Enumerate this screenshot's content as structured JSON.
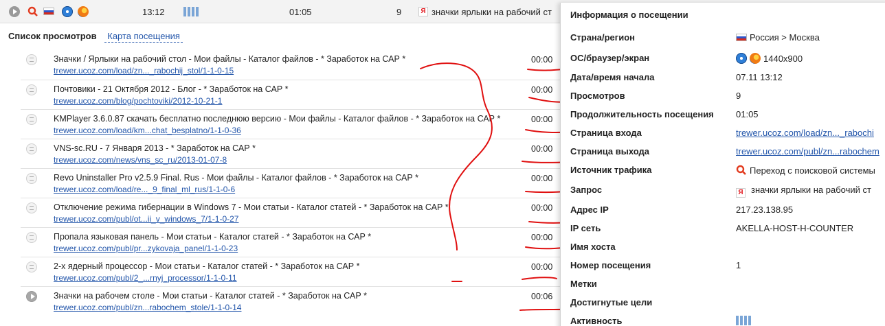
{
  "topbar": {
    "start_time": "13:12",
    "duration": "01:05",
    "views": "9",
    "query": "значки ярлыки на рабочий ст",
    "icons": [
      "play-icon",
      "search-icon",
      "flag-ru-icon",
      "windows-icon",
      "firefox-icon",
      "activity-bars-icon",
      "yandex-icon"
    ]
  },
  "list": {
    "title": "Список просмотров",
    "map_link": "Карта посещения",
    "rows": [
      {
        "title": "Значки / Ярлыки на рабочий стол - Мои файлы - Каталог файлов - * Заработок на САР *",
        "url": "trewer.ucoz.com/load/zn..._rabochij_stol/1-1-0-15",
        "time": "00:00",
        "icon": "doc-icon"
      },
      {
        "title": "Почтовики - 21 Октября 2012 - Блог - * Заработок на САР *",
        "url": "trewer.ucoz.com/blog/pochtoviki/2012-10-21-1",
        "time": "00:00",
        "icon": "doc-icon"
      },
      {
        "title": "KMPlayer 3.6.0.87 скачать бесплатно последнюю версию - Мои файлы - Каталог файлов - * Заработок на САР *",
        "url": "trewer.ucoz.com/load/km...chat_besplatno/1-1-0-36",
        "time": "00:00",
        "icon": "doc-icon"
      },
      {
        "title": "VNS-sc.RU - 7 Января 2013 - * Заработок на САР *",
        "url": "trewer.ucoz.com/news/vns_sc_ru/2013-01-07-8",
        "time": "00:00",
        "icon": "doc-icon"
      },
      {
        "title": "Revo Uninstaller Pro v2.5.9 Final. Rus - Мои файлы - Каталог файлов - * Заработок на САР *",
        "url": "trewer.ucoz.com/load/re..._9_final_ml_rus/1-1-0-6",
        "time": "00:00",
        "icon": "doc-icon"
      },
      {
        "title": "Отключение режима гибернации в Windows 7 - Мои статьи - Каталог статей - * Заработок на САР *",
        "url": "trewer.ucoz.com/publ/ot...ii_v_windows_7/1-1-0-27",
        "time": "00:00",
        "icon": "doc-icon"
      },
      {
        "title": "Пропала языковая панель - Мои статьи - Каталог статей - * Заработок на САР *",
        "url": "trewer.ucoz.com/publ/pr...zykovaja_panel/1-1-0-23",
        "time": "00:00",
        "icon": "doc-icon"
      },
      {
        "title": "2-х ядерный процессор - Мои статьи - Каталог статей - * Заработок на САР *",
        "url": "trewer.ucoz.com/publ/2_...rnyj_processor/1-1-0-11",
        "time": "00:00",
        "icon": "doc-icon"
      },
      {
        "title": "Значки на рабочем столе - Мои статьи - Каталог статей - * Заработок на САР *",
        "url": "trewer.ucoz.com/publ/zn...rabochem_stole/1-1-0-14",
        "time": "00:06",
        "icon": "play-icon"
      }
    ]
  },
  "panel": {
    "title": "Информация о посещении",
    "fields": [
      {
        "label": "Страна/регион",
        "value": "Россия > Москва"
      },
      {
        "label": "ОС/браузер/экран",
        "value": "1440x900"
      },
      {
        "label": "Дата/время начала",
        "value": "07.11 13:12"
      },
      {
        "label": "Просмотров",
        "value": "9"
      },
      {
        "label": "Продолжительность посещения",
        "value": "01:05"
      },
      {
        "label": "Страница входа",
        "value": "trewer.ucoz.com/load/zn..._rabochi"
      },
      {
        "label": "Страница выхода",
        "value": "trewer.ucoz.com/publ/zn...rabochem"
      },
      {
        "label": "Источник трафика",
        "value": "Переход с поисковой системы"
      },
      {
        "label": "Запрос",
        "value": "значки ярлыки на рабочий ст"
      },
      {
        "label": "Адрес IP",
        "value": "217.23.138.95"
      },
      {
        "label": "IP сеть",
        "value": "AKELLA-HOST-H-COUNTER"
      },
      {
        "label": "Имя хоста",
        "value": ""
      },
      {
        "label": "Номер посещения",
        "value": "1"
      },
      {
        "label": "Метки",
        "value": ""
      },
      {
        "label": "Достигнутые цели",
        "value": ""
      },
      {
        "label": "Активность",
        "value": ""
      }
    ]
  },
  "colors": {
    "link": "#2255aa",
    "scribble": "#e01010",
    "activity": "#7aa5d6"
  }
}
